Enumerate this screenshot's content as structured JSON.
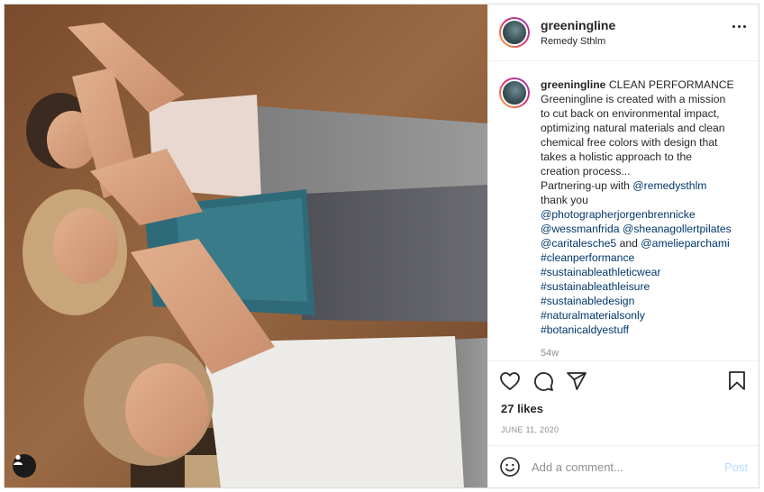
{
  "post": {
    "username": "greeningline",
    "location": "Remedy Sthlm"
  },
  "caption": {
    "username": "greeningline",
    "text_lines": [
      "CLEAN PERFORMANCE",
      "Greeningline is created with a mission",
      "to cut back on environmental impact,",
      "optimizing natural materials and clean",
      "chemical free colors with design that",
      "takes a holistic approach to the",
      "creation process..."
    ],
    "partnering_prefix": "Partnering-up with ",
    "partner_mention": "@remedysthlm",
    "thanks": "thank you",
    "mentions": [
      "@photographerjorgenbrennicke",
      "@wessmanfrida",
      "@sheanagollertpilates",
      "@caritalesche5",
      "@amelieparchami"
    ],
    "and_word": " and ",
    "hashtags": [
      "#cleanperformance",
      "#sustainableathleticwear",
      "#sustainableathleisure",
      "#sustainabledesign",
      "#naturalmaterialsonly",
      "#botanicaldyestuff"
    ],
    "age": "54w"
  },
  "likes": "27 likes",
  "date": "JUNE 11, 2020",
  "comment": {
    "placeholder": "Add a comment...",
    "post_label": "Post"
  },
  "icons": {
    "like": "heart-icon",
    "comment": "comment-icon",
    "share": "paper-plane-icon",
    "save": "bookmark-icon",
    "emoji": "smiley-icon",
    "tag": "user-tag-icon",
    "more": "more-dots-icon"
  },
  "colors": {
    "link": "#00376b",
    "muted": "#8e8e8e",
    "post_disabled": "#b3dbff",
    "story_ring": [
      "#f9b233",
      "#e1306c",
      "#8a3ab9"
    ]
  }
}
